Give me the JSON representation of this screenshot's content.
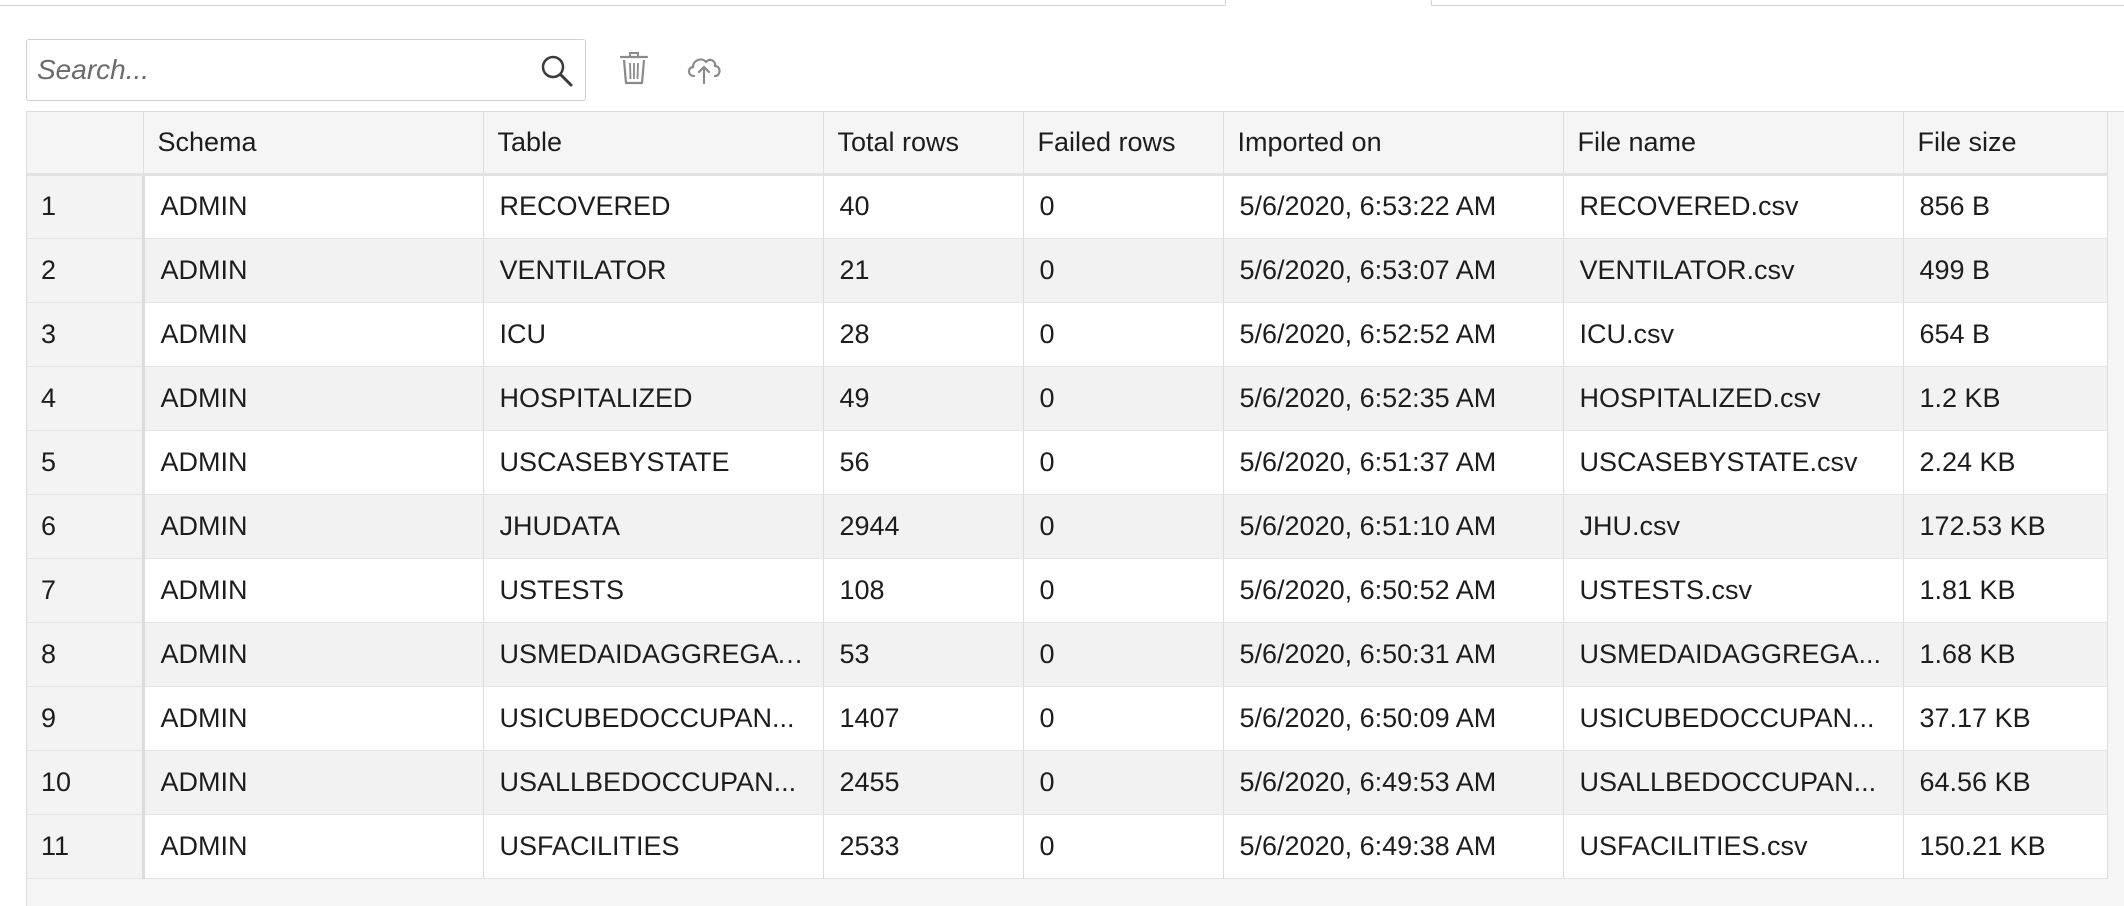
{
  "search": {
    "placeholder": "Search..."
  },
  "toolbar": {
    "search_icon": "magnifier",
    "delete_icon": "trash-can",
    "upload_icon": "cloud-upload"
  },
  "grid": {
    "columns": [
      "",
      "Schema",
      "Table",
      "Total rows",
      "Failed rows",
      "Imported on",
      "File name",
      "File size"
    ],
    "rows": [
      [
        "1",
        "ADMIN",
        "RECOVERED",
        "40",
        "0",
        "5/6/2020, 6:53:22 AM",
        "RECOVERED.csv",
        "856 B"
      ],
      [
        "2",
        "ADMIN",
        "VENTILATOR",
        "21",
        "0",
        "5/6/2020, 6:53:07 AM",
        "VENTILATOR.csv",
        "499 B"
      ],
      [
        "3",
        "ADMIN",
        "ICU",
        "28",
        "0",
        "5/6/2020, 6:52:52 AM",
        "ICU.csv",
        "654 B"
      ],
      [
        "4",
        "ADMIN",
        "HOSPITALIZED",
        "49",
        "0",
        "5/6/2020, 6:52:35 AM",
        "HOSPITALIZED.csv",
        "1.2 KB"
      ],
      [
        "5",
        "ADMIN",
        "USCASEBYSTATE",
        "56",
        "0",
        "5/6/2020, 6:51:37 AM",
        "USCASEBYSTATE.csv",
        "2.24 KB"
      ],
      [
        "6",
        "ADMIN",
        "JHUDATA",
        "2944",
        "0",
        "5/6/2020, 6:51:10 AM",
        "JHU.csv",
        "172.53 KB"
      ],
      [
        "7",
        "ADMIN",
        "USTESTS",
        "108",
        "0",
        "5/6/2020, 6:50:52 AM",
        "USTESTS.csv",
        "1.81 KB"
      ],
      [
        "8",
        "ADMIN",
        "USMEDAIDAGGREGATE",
        "53",
        "0",
        "5/6/2020, 6:50:31 AM",
        "USMEDAIDAGGREGA...",
        "1.68 KB"
      ],
      [
        "9",
        "ADMIN",
        "USICUBEDOCCUPAN...",
        "1407",
        "0",
        "5/6/2020, 6:50:09 AM",
        "USICUBEDOCCUPAN...",
        "37.17 KB"
      ],
      [
        "10",
        "ADMIN",
        "USALLBEDOCCUPAN...",
        "2455",
        "0",
        "5/6/2020, 6:49:53 AM",
        "USALLBEDOCCUPAN...",
        "64.56 KB"
      ],
      [
        "11",
        "ADMIN",
        "USFACILITIES",
        "2533",
        "0",
        "5/6/2020, 6:49:38 AM",
        "USFACILITIES.csv",
        "150.21 KB"
      ]
    ]
  }
}
